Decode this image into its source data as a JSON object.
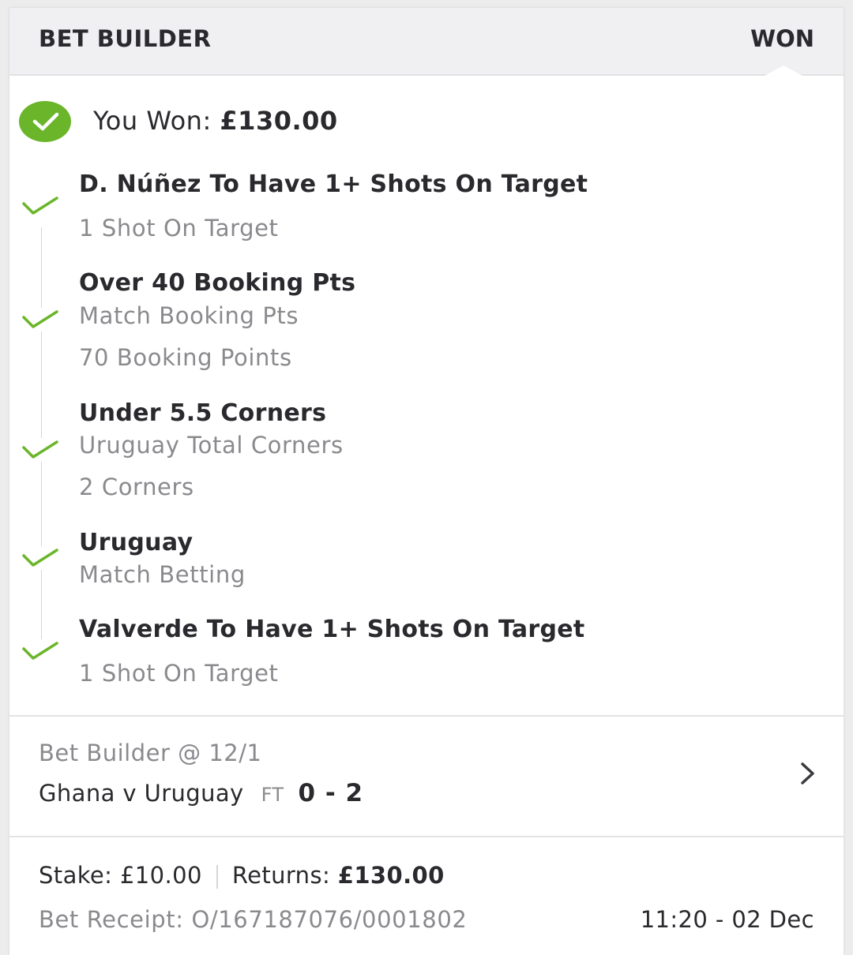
{
  "header": {
    "title": "BET BUILDER",
    "status": "WON"
  },
  "result": {
    "label": "You Won:",
    "amount": "£130.00"
  },
  "legs": [
    {
      "title": "D. Núñez To Have 1+ Shots On Target",
      "market": "",
      "outcome": "1 Shot On Target",
      "status": "won"
    },
    {
      "title": "Over 40 Booking Pts",
      "market": "Match Booking Pts",
      "outcome": "70 Booking Points",
      "status": "won"
    },
    {
      "title": "Under 5.5 Corners",
      "market": "Uruguay Total Corners",
      "outcome": "2 Corners",
      "status": "won"
    },
    {
      "title": "Uruguay",
      "market": "Match Betting",
      "outcome": "",
      "status": "won"
    },
    {
      "title": "Valverde To Have 1+ Shots On Target",
      "market": "",
      "outcome": "1 Shot On Target",
      "status": "won"
    }
  ],
  "bet": {
    "type_label": "Bet Builder @",
    "odds": "12/1",
    "match": "Ghana v Uruguay",
    "match_status": "FT",
    "score": "0 - 2"
  },
  "summary": {
    "stake_label": "Stake:",
    "stake_value": "£10.00",
    "returns_label": "Returns:",
    "returns_value": "£130.00",
    "receipt_label": "Bet Receipt:",
    "receipt_value": "O/167187076/0001802",
    "placed_time": "11:20 - 02 Dec"
  },
  "colors": {
    "success_green": "#6bb52a",
    "header_bg": "#f0f0f2",
    "muted_text": "#8a8a8e",
    "primary_text": "#2a2a2e"
  },
  "icons": {
    "won_badge": "check-circle-icon",
    "leg_status": "check-icon",
    "details": "chevron-right-icon"
  }
}
